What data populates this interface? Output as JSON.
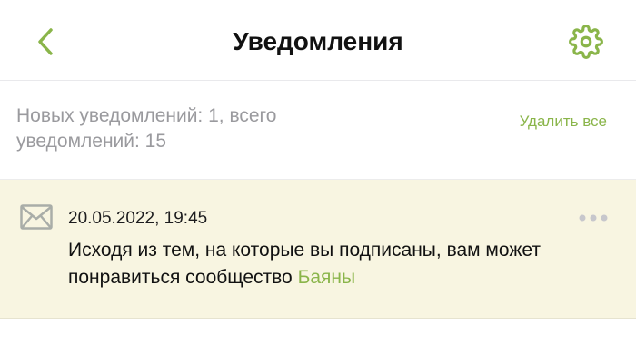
{
  "header": {
    "title": "Уведомления",
    "back_icon": "chevron-left-icon",
    "settings_icon": "gear-icon"
  },
  "summary": {
    "text": "Новых уведомлений: 1, всего уведомлений: 15",
    "delete_all_label": "Удалить все"
  },
  "notifications": [
    {
      "icon": "envelope-icon",
      "date": "20.05.2022, 19:45",
      "message_prefix": "Исходя из тем, на которые вы подписаны, вам может понравиться сообщество ",
      "community_name": "Баяны",
      "more_icon": "more-dots-icon"
    }
  ],
  "colors": {
    "accent": "#8ab54a",
    "muted_text": "#9a9a9e",
    "unread_background": "#f8f5e1"
  }
}
